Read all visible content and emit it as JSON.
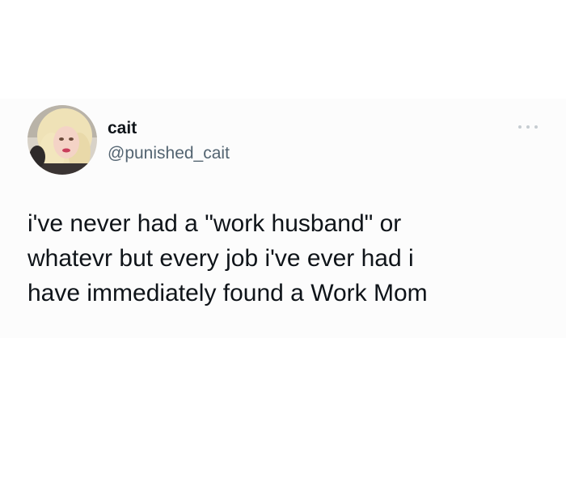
{
  "tweet": {
    "display_name": "cait",
    "handle": "@punished_cait",
    "text_lines": [
      "i've never had a \"work husband\" or",
      "whatevr but every job i've ever had i",
      "have immediately found a Work Mom"
    ],
    "avatar_icon": "profile-photo",
    "more_icon": "more-options-icon"
  }
}
